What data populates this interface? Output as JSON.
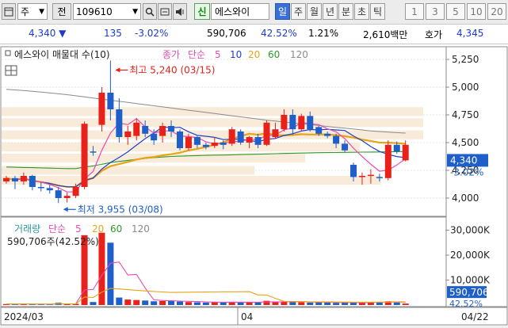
{
  "toolbar": {
    "window_icon": "window-icon",
    "type_label": "주",
    "prefix_label": "전",
    "stock_code": "109610",
    "search_icon": "search-icon",
    "filter_icon": "q-filter-icon",
    "speaker_icon": "speaker-icon",
    "credit_badge": "신",
    "stock_name": "에스와이",
    "periods": [
      "일",
      "주",
      "월",
      "년",
      "분",
      "초",
      "틱"
    ],
    "active_period": "일",
    "intervals": [
      "1",
      "3",
      "5",
      "10",
      "20"
    ]
  },
  "quote": {
    "price": "4,340",
    "change": "135",
    "change_pct": "-3.02%",
    "volume": "590,706",
    "volume_ratio": "42.52%",
    "turnover_pct": "1.21%",
    "amount": "2,610백만",
    "ask_label": "호가",
    "ask_price": "4,345"
  },
  "price_chart": {
    "legend_title": "에스와이 매물대 수(10)",
    "legend_close": "종가",
    "legend_ma_label": "단순",
    "legend_ma_periods": [
      "5",
      "10",
      "20",
      "60",
      "120"
    ],
    "high_annotation": "최고 5,240 (03/15)",
    "low_annotation": "최저 3,955 (03/08)",
    "y_ticks": [
      "5,250",
      "5,000",
      "4,750",
      "4,500",
      "4,250",
      "4,000"
    ],
    "current_price_label": "4,340",
    "current_change_label": "-3.02%"
  },
  "volume_chart": {
    "legend_title": "거래량",
    "legend_ma_label": "단순",
    "legend_ma_periods": [
      "5",
      "20",
      "60",
      "120"
    ],
    "current_volume_text": "590,706주(42.52%)",
    "y_ticks": [
      "30,000K",
      "20,000K",
      "10,000K"
    ],
    "current_volume_label": "590,706",
    "current_ratio_label": "42.52%"
  },
  "x_axis": {
    "labels": [
      "2024/03",
      "04",
      "04/22"
    ]
  },
  "colors": {
    "up": "#e8211b",
    "down": "#1f5fc9",
    "ma5": "#e64bb5",
    "ma10": "#1f3fc9",
    "ma20": "#e8a317",
    "ma60": "#2c9a2c",
    "ma120": "#8a8a8a"
  },
  "chart_data": {
    "type": "candlestick",
    "candles": [
      [
        4150,
        4200,
        4130,
        4180
      ],
      [
        4180,
        4200,
        4080,
        4150
      ],
      [
        4150,
        4230,
        4120,
        4200
      ],
      [
        4200,
        4210,
        4070,
        4100
      ],
      [
        4100,
        4140,
        4060,
        4090
      ],
      [
        4090,
        4120,
        4040,
        4070
      ],
      [
        4070,
        4100,
        3955,
        4000
      ],
      [
        4000,
        4050,
        3960,
        4020
      ],
      [
        4020,
        4130,
        4000,
        4100
      ],
      [
        4100,
        4690,
        4080,
        4670
      ],
      [
        4420,
        4470,
        4380,
        4410
      ],
      [
        4660,
        5000,
        4600,
        4950
      ],
      [
        4950,
        5240,
        4700,
        4800
      ],
      [
        4800,
        4900,
        4500,
        4550
      ],
      [
        4550,
        4650,
        4480,
        4600
      ],
      [
        4560,
        4720,
        4520,
        4680
      ],
      [
        4650,
        4700,
        4550,
        4580
      ],
      [
        4580,
        4620,
        4480,
        4520
      ],
      [
        4560,
        4680,
        4500,
        4650
      ],
      [
        4650,
        4700,
        4550,
        4600
      ],
      [
        4600,
        4620,
        4430,
        4450
      ],
      [
        4450,
        4580,
        4430,
        4550
      ],
      [
        4550,
        4560,
        4450,
        4480
      ],
      [
        4480,
        4500,
        4440,
        4460
      ],
      [
        4470,
        4550,
        4450,
        4500
      ],
      [
        4500,
        4520,
        4440,
        4480
      ],
      [
        4490,
        4640,
        4470,
        4620
      ],
      [
        4600,
        4620,
        4480,
        4500
      ],
      [
        4500,
        4560,
        4450,
        4550
      ],
      [
        4550,
        4580,
        4450,
        4480
      ],
      [
        4480,
        4700,
        4470,
        4680
      ],
      [
        4550,
        4680,
        4540,
        4620
      ],
      [
        4620,
        4800,
        4600,
        4750
      ],
      [
        4750,
        4800,
        4570,
        4620
      ],
      [
        4620,
        4760,
        4600,
        4740
      ],
      [
        4740,
        4780,
        4600,
        4620
      ],
      [
        4640,
        4650,
        4560,
        4580
      ],
      [
        4580,
        4600,
        4540,
        4560
      ],
      [
        4560,
        4580,
        4450,
        4490
      ],
      [
        4490,
        4520,
        4410,
        4430
      ],
      [
        4300,
        4320,
        4150,
        4190
      ],
      [
        4190,
        4230,
        4120,
        4200
      ],
      [
        4200,
        4260,
        4130,
        4210
      ],
      [
        4190,
        4220,
        4150,
        4180
      ],
      [
        4180,
        4520,
        4160,
        4480
      ],
      [
        4480,
        4510,
        4400,
        4420
      ],
      [
        4340,
        4520,
        4330,
        4480
      ]
    ],
    "volume_k": [
      400,
      350,
      500,
      320,
      280,
      260,
      900,
      600,
      500,
      28000,
      1200,
      29000,
      25000,
      3000,
      2200,
      2000,
      1800,
      1500,
      1600,
      1700,
      1400,
      1200,
      1100,
      1000,
      1200,
      1100,
      1300,
      1050,
      1000,
      1100,
      1700,
      1300,
      1400,
      1200,
      1100,
      1000,
      1200,
      1000,
      900,
      950,
      1100,
      1000,
      1200,
      1300,
      1500,
      1389,
      591
    ],
    "bands": [
      {
        "low": 4120,
        "high": 4200,
        "weight": 0.9
      },
      {
        "low": 4210,
        "high": 4290,
        "weight": 0.6
      },
      {
        "low": 4320,
        "high": 4400,
        "weight": 0.72
      },
      {
        "low": 4420,
        "high": 4500,
        "weight": 0.85
      },
      {
        "low": 4530,
        "high": 4610,
        "weight": 1.0
      },
      {
        "low": 4640,
        "high": 4720,
        "weight": 1.0
      },
      {
        "low": 4740,
        "high": 4820,
        "weight": 1.0
      }
    ],
    "ma120": [
      4980,
      4975,
      4970,
      4962,
      4955,
      4948,
      4940,
      4932,
      4922,
      4912,
      4902,
      4892,
      4882,
      4872,
      4862,
      4852,
      4842,
      4832,
      4822,
      4812,
      4802,
      4792,
      4782,
      4772,
      4762,
      4752,
      4742,
      4732,
      4722,
      4712,
      4702,
      4694,
      4686,
      4678,
      4670,
      4662,
      4654,
      4646,
      4638,
      4630,
      4622,
      4614,
      4606,
      4600,
      4595,
      4590,
      4586
    ],
    "ma60": [
      4280,
      4278,
      4276,
      4274,
      4272,
      4270,
      4268,
      4266,
      4266,
      4280,
      4290,
      4305,
      4320,
      4330,
      4340,
      4350,
      4358,
      4364,
      4370,
      4375,
      4378,
      4381,
      4383,
      4385,
      4387,
      4388,
      4390,
      4392,
      4394,
      4396,
      4398,
      4400,
      4402,
      4404,
      4406,
      4408,
      4409,
      4410,
      4411,
      4412,
      4413,
      4414,
      4415,
      4416,
      4417,
      4418,
      4419
    ],
    "ylim": [
      3850,
      5350
    ],
    "volume_ylim": [
      0,
      34000
    ]
  }
}
